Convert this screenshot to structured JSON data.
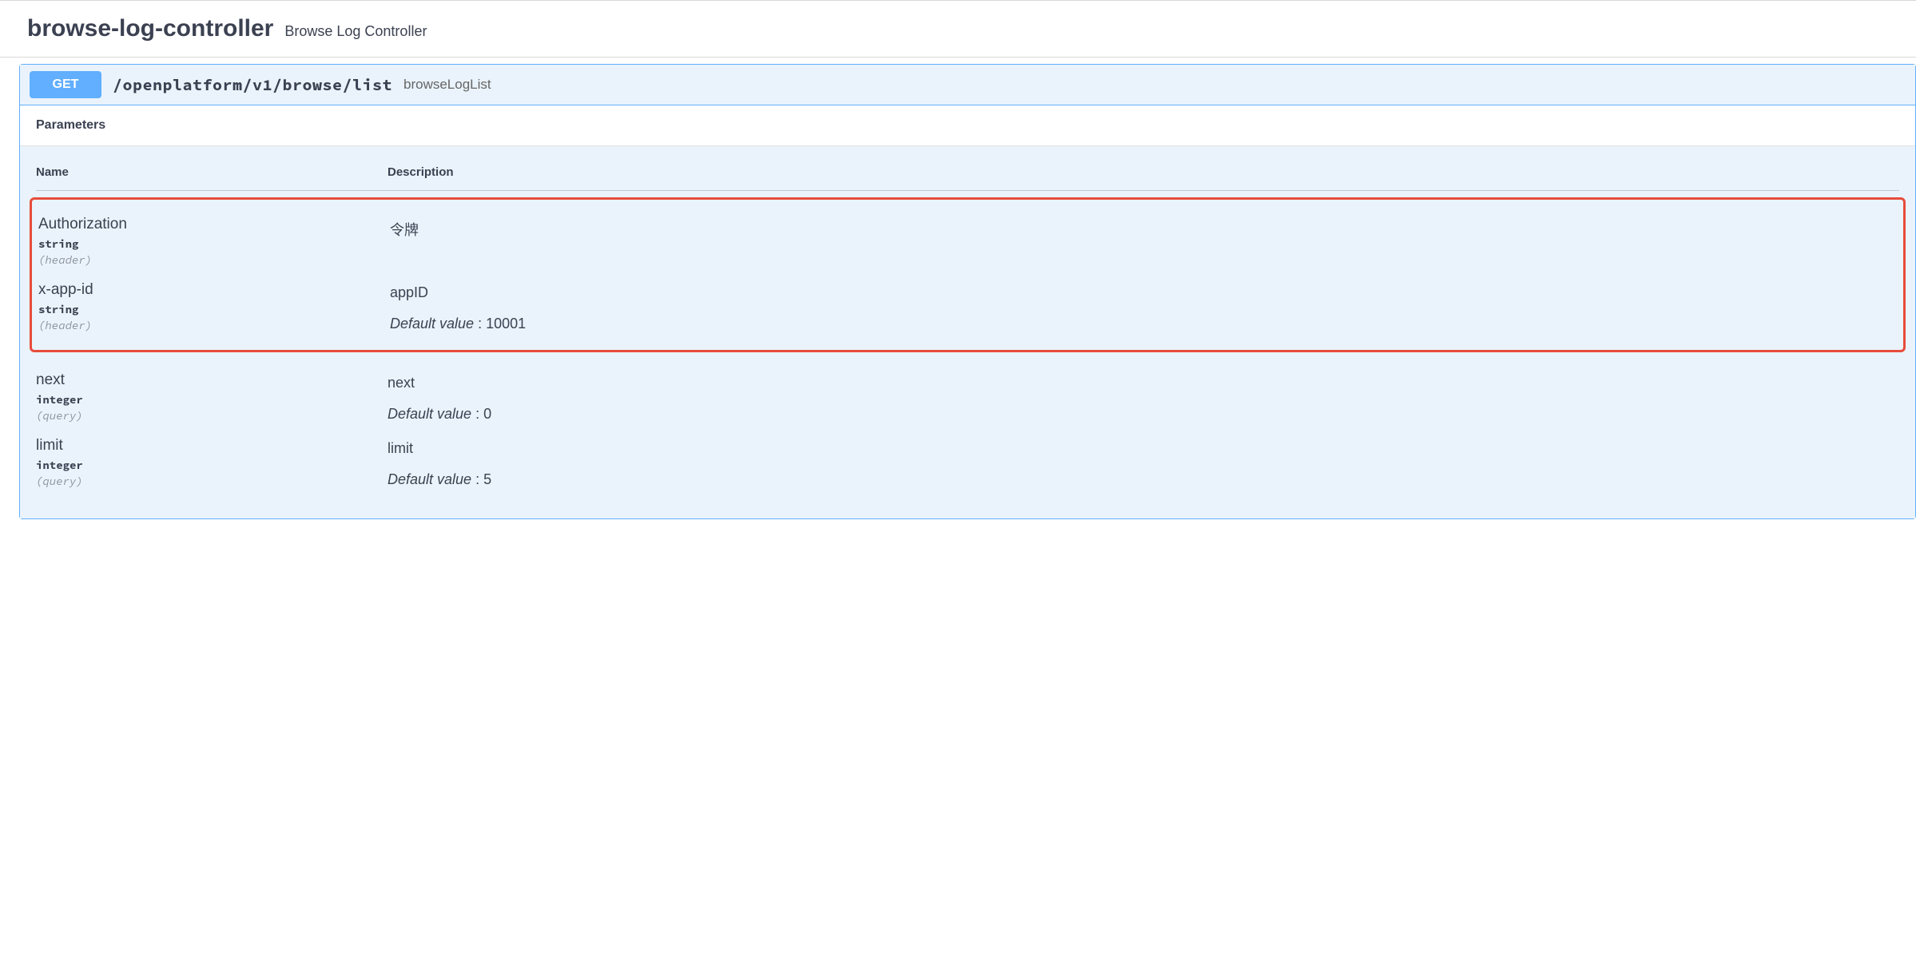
{
  "tag": {
    "name": "browse-log-controller",
    "description": "Browse Log Controller"
  },
  "operation": {
    "method": "GET",
    "path": "/openplatform/v1/browse/list",
    "summary": "browseLogList"
  },
  "parameters_section": {
    "title": "Parameters",
    "columns": {
      "name": "Name",
      "description": "Description"
    }
  },
  "parameters": [
    {
      "name": "Authorization",
      "type": "string",
      "in": "(header)",
      "description": "令牌",
      "default_label": "",
      "default_value": "",
      "highlighted": true
    },
    {
      "name": "x-app-id",
      "type": "string",
      "in": "(header)",
      "description": "appID",
      "default_label": "Default value",
      "default_value": " : 10001",
      "highlighted": true
    },
    {
      "name": "next",
      "type": "integer",
      "in": "(query)",
      "description": "next",
      "default_label": "Default value",
      "default_value": " : 0",
      "highlighted": false
    },
    {
      "name": "limit",
      "type": "integer",
      "in": "(query)",
      "description": "limit",
      "default_label": "Default value",
      "default_value": " : 5",
      "highlighted": false
    }
  ]
}
